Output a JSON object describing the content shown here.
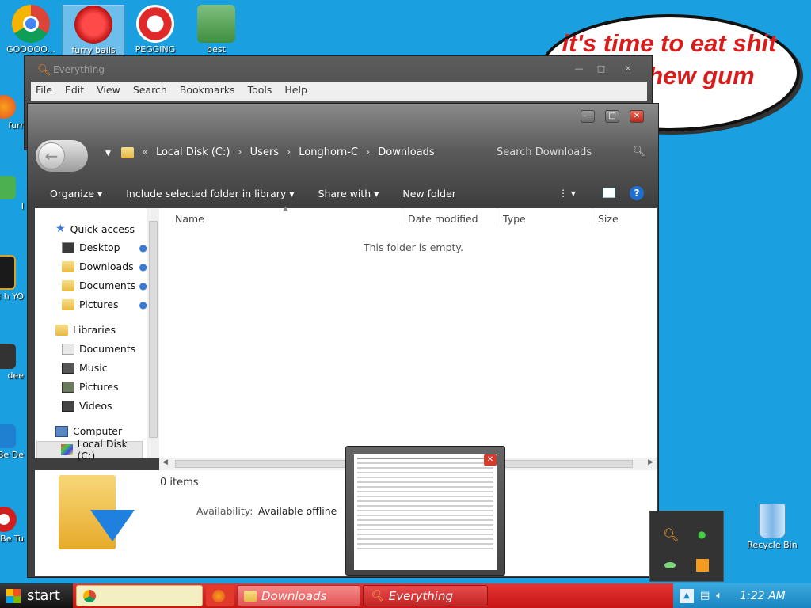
{
  "desktop": {
    "icons_top": [
      {
        "label": "GOOOOO..."
      },
      {
        "label": "furry balls"
      },
      {
        "label": "PEGGING"
      },
      {
        "label": "best howling..."
      }
    ],
    "icons_left": [
      {
        "label": "furr"
      },
      {
        "label": "I"
      },
      {
        "label": "I h YO"
      },
      {
        "label": "dee"
      },
      {
        "label": "Be De"
      },
      {
        "label": "Be Tu"
      }
    ],
    "recycle_bin": "Recycle Bin"
  },
  "bubble": {
    "text": "it's time to eat shit and chew gum"
  },
  "everything_window": {
    "title": "Everything",
    "menu": [
      "File",
      "Edit",
      "View",
      "Search",
      "Bookmarks",
      "Tools",
      "Help"
    ]
  },
  "explorer": {
    "breadcrumb": [
      "Local Disk (C:)",
      "Users",
      "Longhorn-C",
      "Downloads"
    ],
    "search_placeholder": "Search Downloads",
    "toolbar": {
      "organize": "Organize",
      "include": "Include selected folder in library",
      "share": "Share with",
      "new_folder": "New folder"
    },
    "nav": {
      "quick_access": "Quick access",
      "qa_items": [
        "Desktop",
        "Downloads",
        "Documents",
        "Pictures"
      ],
      "libraries": "Libraries",
      "lib_items": [
        "Documents",
        "Music",
        "Pictures",
        "Videos"
      ],
      "computer": "Computer",
      "local_disk": "Local Disk (C:)"
    },
    "columns": [
      "Name",
      "Date modified",
      "Type",
      "Size"
    ],
    "empty_message": "This folder is empty.",
    "details": {
      "count": "0 items",
      "availability_label": "Availability:",
      "availability_value": "Available offline"
    }
  },
  "taskbar": {
    "start": "start",
    "tasks": {
      "downloads": "Downloads",
      "everything": "Everything"
    },
    "clock": "1:22 AM"
  },
  "colors": {
    "taskbar": "#d42020",
    "desktop": "#1aa0e0",
    "bubble_text": "#d81c1c"
  }
}
